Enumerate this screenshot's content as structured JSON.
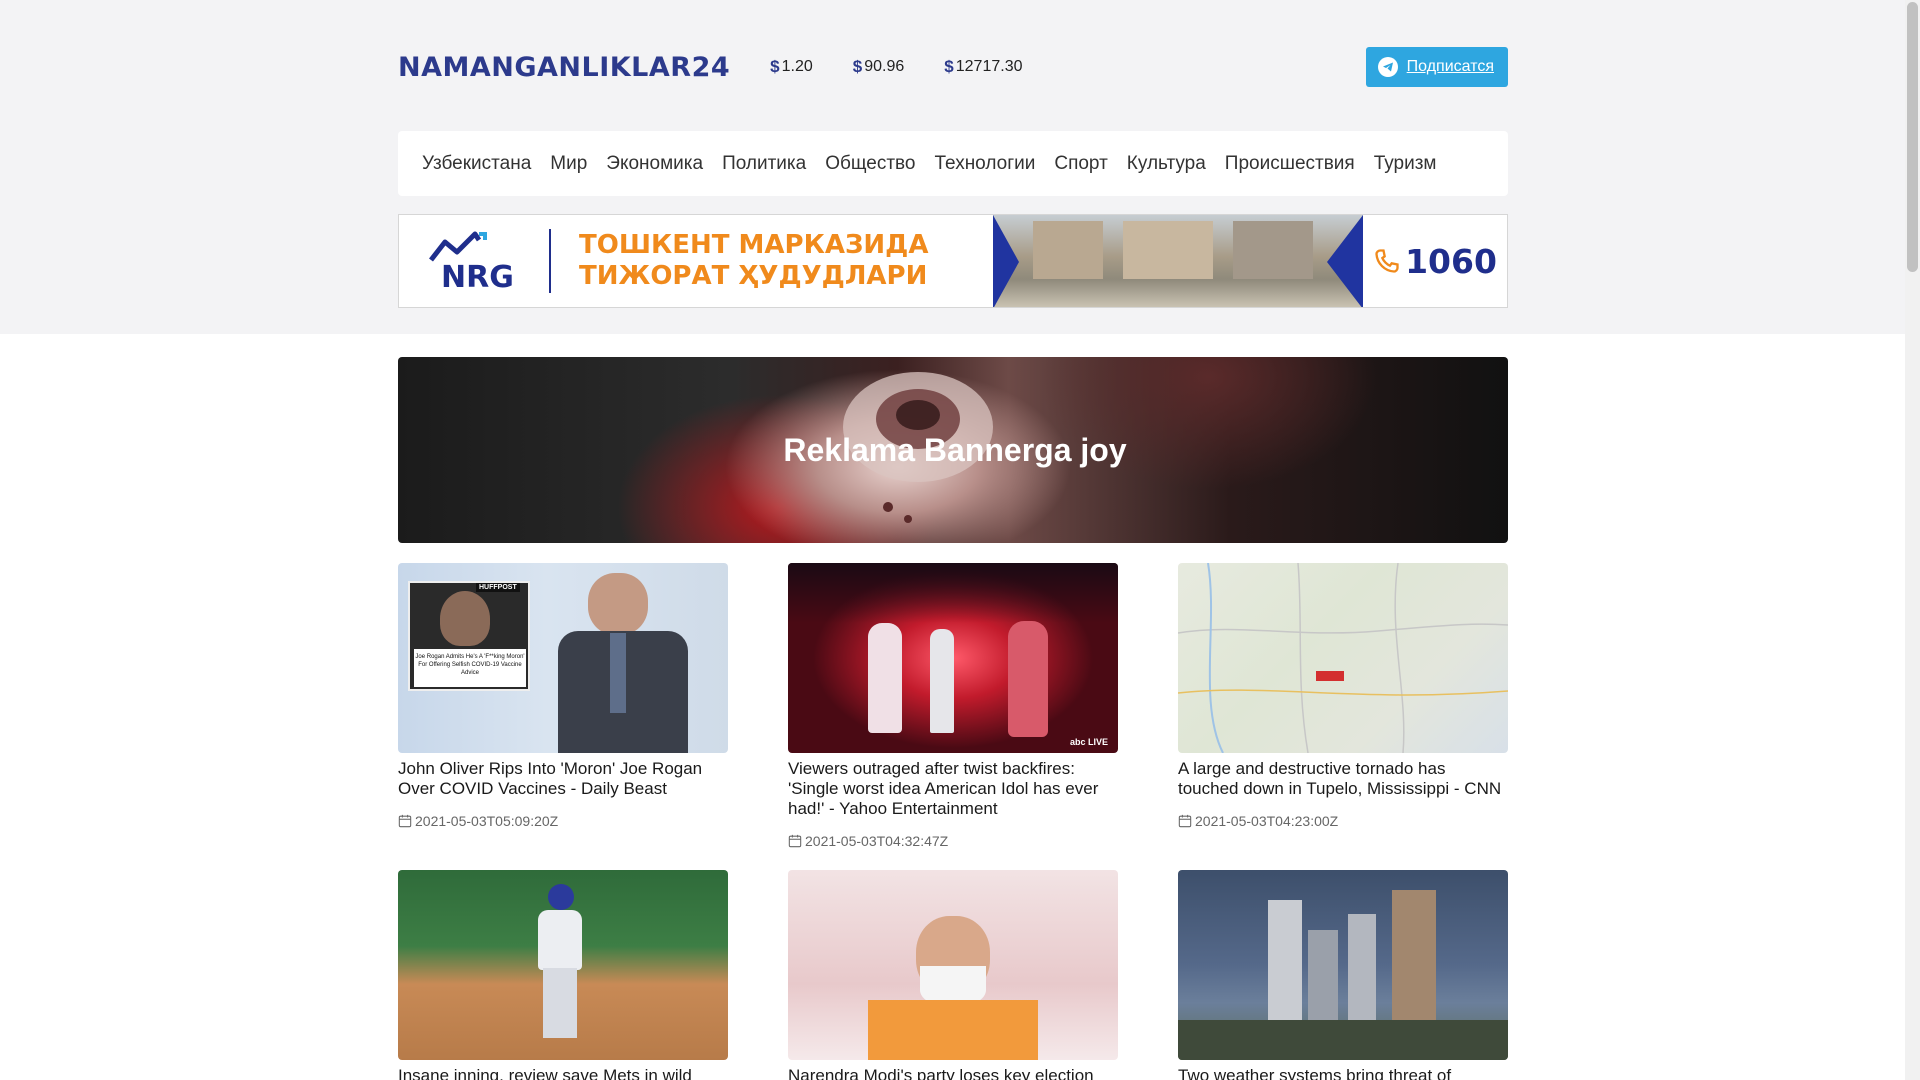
{
  "site": {
    "logo": "NAMANGANLIKLAR24"
  },
  "rates": [
    {
      "symbol": "$",
      "value": "1.20"
    },
    {
      "symbol": "$",
      "value": "90.96"
    },
    {
      "symbol": "$",
      "value": "12717.30"
    }
  ],
  "subscribe": {
    "label": "Подписатся",
    "icon": "telegram-icon",
    "color": "#2ea6e0"
  },
  "nav": {
    "items": [
      "Узбекистана",
      "Мир",
      "Экономика",
      "Политика",
      "Общество",
      "Технологии",
      "Спорт",
      "Культура",
      "Происшествия",
      "Туризм"
    ]
  },
  "ad_top": {
    "brand": "NRG",
    "line1": "ТОШКЕНТ МАРКАЗИДА",
    "line2": "ТИЖОРАТ ҲУДУДЛАРИ",
    "phone": "1060",
    "accent": "#f08a1c",
    "brand_color": "#1f2e8c"
  },
  "ad_banner": {
    "title": "Reklama Bannerga joy"
  },
  "articles": [
    {
      "title": "John Oliver Rips Into 'Moron' Joe Rogan Over COVID Vaccines - Daily Beast",
      "date": "2021-05-03T05:09:20Z",
      "thumb_caption": "Joe Rogan Admits He's A 'F**king Moron' For Offering Selfish COVID-19 Vaccine Advice",
      "thumb_badge": "HUFFPOST"
    },
    {
      "title": "Viewers outraged after twist backfires: 'Single worst idea American Idol has ever had!' - Yahoo Entertainment",
      "date": "2021-05-03T04:32:47Z",
      "thumb_badge": "abc LIVE"
    },
    {
      "title": "A large and destructive tornado has touched down in Tupelo, Mississippi - CNN",
      "date": "2021-05-03T04:23:00Z"
    },
    {
      "title": "Insane inning, review save Mets in wild",
      "date": ""
    },
    {
      "title": "Narendra Modi's party loses key election",
      "date": ""
    },
    {
      "title": "Two weather systems bring threat of",
      "date": ""
    }
  ]
}
